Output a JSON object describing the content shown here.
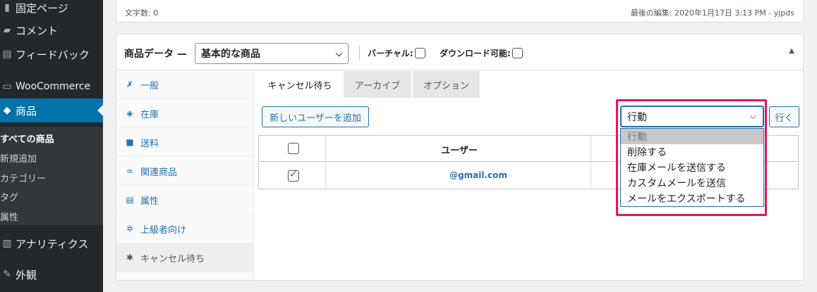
{
  "sidebar": {
    "items": [
      {
        "label": "固定ページ",
        "icon": "pages-icon"
      },
      {
        "label": "コメント",
        "icon": "comment-icon"
      },
      {
        "label": "フィードバック",
        "icon": "feedback-icon"
      },
      {
        "label": "WooCommerce",
        "icon": "woocommerce-icon"
      },
      {
        "label": "商品",
        "icon": "product-icon"
      },
      {
        "label": "アナリティクス",
        "icon": "analytics-icon"
      },
      {
        "label": "外観",
        "icon": "appearance-icon"
      }
    ],
    "submenu": [
      "すべての商品",
      "新規追加",
      "カテゴリー",
      "タグ",
      "属性"
    ]
  },
  "top_box": {
    "word_count": "文字数: 0",
    "last_edit": "最後の編集: 2020年1月17日 3:13 PM - yjpds"
  },
  "product_data": {
    "title": "商品データ —",
    "type_select": "基本的な商品",
    "virtual_label": "バーチャル:",
    "downloadable_label": "ダウンロード可能:",
    "tabs": [
      {
        "label": "一般",
        "icon": "wrench-icon"
      },
      {
        "label": "在庫",
        "icon": "tag-icon"
      },
      {
        "label": "送料",
        "icon": "truck-icon"
      },
      {
        "label": "関連商品",
        "icon": "link-icon"
      },
      {
        "label": "属性",
        "icon": "list-icon"
      },
      {
        "label": "上級者向け",
        "icon": "gear-icon"
      },
      {
        "label": "キャンセル待ち",
        "icon": "bug-icon"
      }
    ],
    "inner_tabs": [
      "キャンセル待ち",
      "アーカイブ",
      "オプション"
    ],
    "add_user_button": "新しいユーザーを追加",
    "go_button": "行く",
    "action_select": "行動",
    "action_options": [
      "行動",
      "削除する",
      "在庫メールを送信する",
      "カスタムメールを送信",
      "メールをエクスポートする"
    ],
    "table": {
      "header_user": "ユーザー",
      "rows": [
        {
          "email": "@gmail.com",
          "checked": true
        }
      ]
    }
  },
  "colors": {
    "sidebar_bg": "#23282d",
    "active_blue": "#0073aa",
    "link_blue": "#2271b1",
    "highlight": "#e3165b"
  }
}
